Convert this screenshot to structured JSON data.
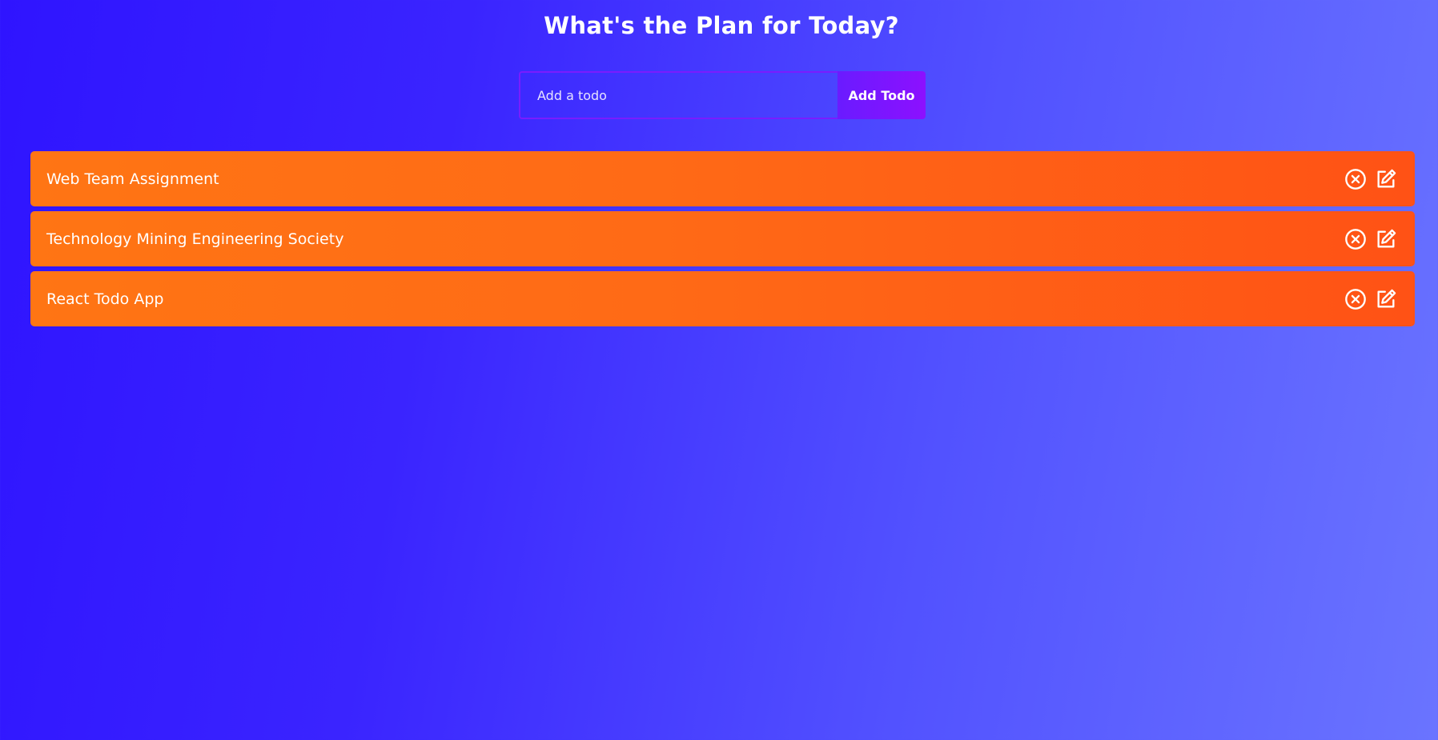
{
  "header": {
    "title": "What's the Plan for Today?"
  },
  "form": {
    "input_placeholder": "Add a todo",
    "input_value": "",
    "button_label": "Add Todo"
  },
  "todos": [
    {
      "text": "Web Team Assignment",
      "delete_icon": "close-circle-icon",
      "edit_icon": "edit-icon"
    },
    {
      "text": "Technology Mining Engineering Society",
      "delete_icon": "close-circle-icon",
      "edit_icon": "edit-icon"
    },
    {
      "text": "React Todo App",
      "delete_icon": "close-circle-icon",
      "edit_icon": "edit-icon"
    }
  ],
  "colors": {
    "background_start": "#2f14ff",
    "background_end": "#6a74ff",
    "row_start": "#ff7514",
    "row_end": "#ff5215",
    "button": "#8c10ff",
    "input_border": "#7a1cff"
  }
}
